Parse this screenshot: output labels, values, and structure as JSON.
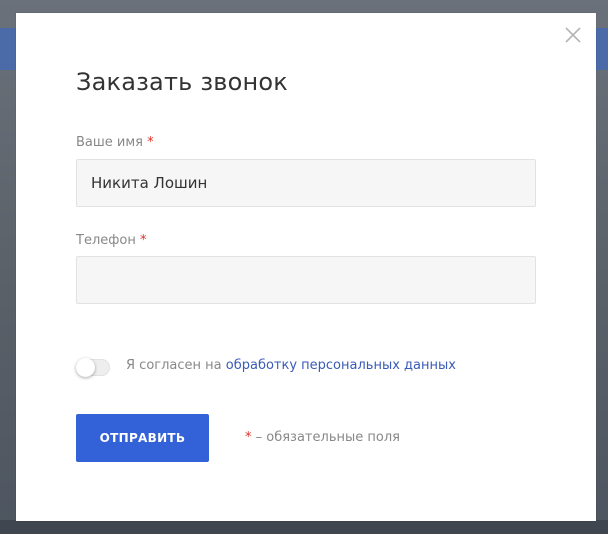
{
  "modal": {
    "title": "Заказать звонок",
    "close_label": "×"
  },
  "form": {
    "name": {
      "label": "Ваше имя",
      "required_mark": "*",
      "value": "Никита Лошин"
    },
    "phone": {
      "label": "Телефон",
      "required_mark": "*",
      "value": ""
    },
    "consent": {
      "checked": false,
      "text": "Я согласен на ",
      "link_text": "обработку персональных данных"
    },
    "submit_label": "ОТПРАВИТЬ",
    "required_note": {
      "mark": "*",
      "text": " – обязательные поля"
    }
  },
  "colors": {
    "accent": "#3361d8",
    "link": "#3a5bb8",
    "required": "#e0302a"
  }
}
